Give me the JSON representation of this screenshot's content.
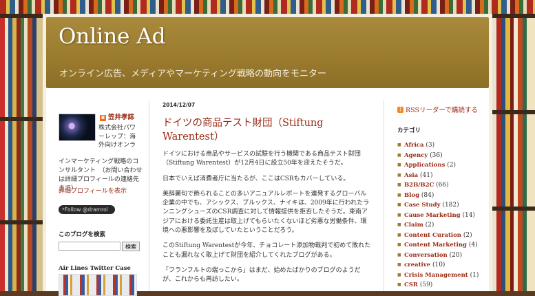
{
  "site": {
    "title": "Online Ad",
    "description": "オンライン広告、メディアやマーケティング戦略の動向をモニター"
  },
  "profile": {
    "name": "笠井孝誌",
    "bio_short": "株式会社パワーレップ：海外向けオンラ",
    "bio_rest": "インマーケティング戦略のコンサルタント　（お問い合わせは詳細プロフィールの連絡先まで）",
    "profile_link": "詳細プロフィールを表示",
    "follow_label": "Follow @dramrol"
  },
  "search": {
    "heading": "このブログを検索",
    "button": "検索",
    "placeholder": ""
  },
  "airlines": {
    "heading": "Air Lines Twitter Case Study"
  },
  "post": {
    "date": "2014/12/07",
    "title": "ドイツの商品テスト財団（Stiftung Warentest）",
    "paragraphs": [
      "ドイツにおける商品やサービスの試験を行う機関である商品テスト財団（Stiftung Warentest）が12月4日に設立50年を迎えたそうだ。",
      "日本でいえば消費者庁に当たるが、ここはCSRもカバーしている。",
      "美辞麗句で飾られることの多いアニュアルレポートを連発するグローバル企業の中でも、アシックス、ブルックス、ナイキは、2009年に行われたランニングシューズのCSR調査に対して情報提供を拒否したそうだ。東南アジアにおける委託生産は取上げてもらいたくないほど劣悪な労働条件、環境への悪影響を及ぼしていたということだろう。",
      "このStiftung Warentestが今年、チョコレート添加物裁判で初めて敗れたことも漏れなく取上げて財団を紹介してくれたブログがある。",
      "「フランフルトの端っこから」はまだ、始めたばかりのブログのようだが、これからも再訪したい。"
    ]
  },
  "sidebar_right": {
    "rss": "RSSリーダーで購読する",
    "categories_heading": "カテゴリ",
    "categories": [
      {
        "name": "Africa",
        "count": "(3)"
      },
      {
        "name": "Agency",
        "count": "(36)"
      },
      {
        "name": "Applications",
        "count": "(2)"
      },
      {
        "name": "Asia",
        "count": "(41)"
      },
      {
        "name": "B2B/B2C",
        "count": "(66)"
      },
      {
        "name": "Blog",
        "count": "(84)"
      },
      {
        "name": "Case Study",
        "count": "(182)"
      },
      {
        "name": "Cause Marketing",
        "count": "(14)"
      },
      {
        "name": "Claim",
        "count": "(2)"
      },
      {
        "name": "Content Curation",
        "count": "(2)"
      },
      {
        "name": "Content Marketing",
        "count": "(4)"
      },
      {
        "name": "Conversation",
        "count": "(20)"
      },
      {
        "name": "creative",
        "count": "(10)"
      },
      {
        "name": "Crisis Management",
        "count": "(1)"
      },
      {
        "name": "CSR",
        "count": "(59)"
      }
    ]
  },
  "colors": {
    "header_gold": "#9b7c2f",
    "link_red": "#9b2a14"
  }
}
